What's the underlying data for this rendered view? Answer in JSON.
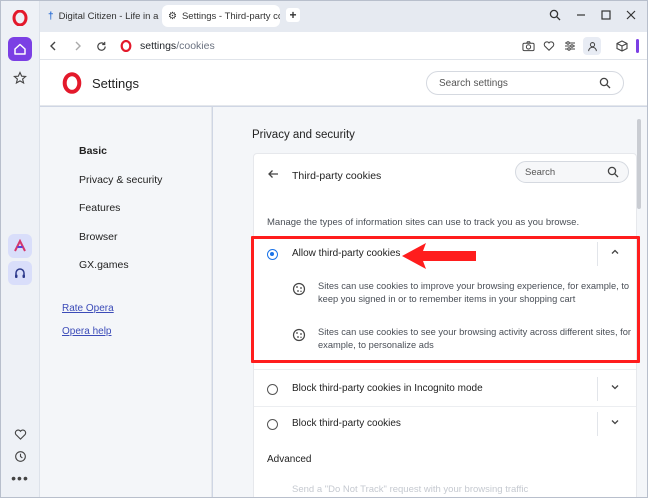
{
  "tabs": [
    {
      "label": "Digital Citizen - Life in a digital world"
    },
    {
      "label": "Settings - Third-party cookies"
    }
  ],
  "address": {
    "host": "settings",
    "path": "/cookies"
  },
  "settings": {
    "title": "Settings",
    "search_placeholder": "Search settings"
  },
  "sidebar": {
    "items": [
      {
        "label": "Basic"
      },
      {
        "label": "Privacy & security"
      },
      {
        "label": "Features"
      },
      {
        "label": "Browser"
      },
      {
        "label": "GX.games"
      }
    ],
    "links": [
      {
        "label": "Rate Opera"
      },
      {
        "label": "Opera help"
      }
    ]
  },
  "main": {
    "section_title": "Privacy and security",
    "card_title": "Third-party cookies",
    "search_placeholder": "Search",
    "description": "Manage the types of information sites can use to track you as you browse.",
    "options": [
      {
        "label": "Allow third-party cookies",
        "selected": true,
        "expanded": true,
        "details": [
          "Sites can use cookies to improve your browsing experience, for example, to keep you signed in or to remember items in your shopping cart",
          "Sites can use cookies to see your browsing activity across different sites, for example, to personalize ads"
        ]
      },
      {
        "label": "Block third-party cookies in Incognito mode",
        "selected": false,
        "expanded": false
      },
      {
        "label": "Block third-party cookies",
        "selected": false,
        "expanded": false
      }
    ],
    "advanced_label": "Advanced",
    "faded_text": "Send a \"Do Not Track\" request with your browsing traffic"
  },
  "colors": {
    "accent": "#7b3fe4",
    "radio_selected": "#1a73e8",
    "highlight": "#ff1d1d",
    "opera_red": "#e3192b"
  }
}
